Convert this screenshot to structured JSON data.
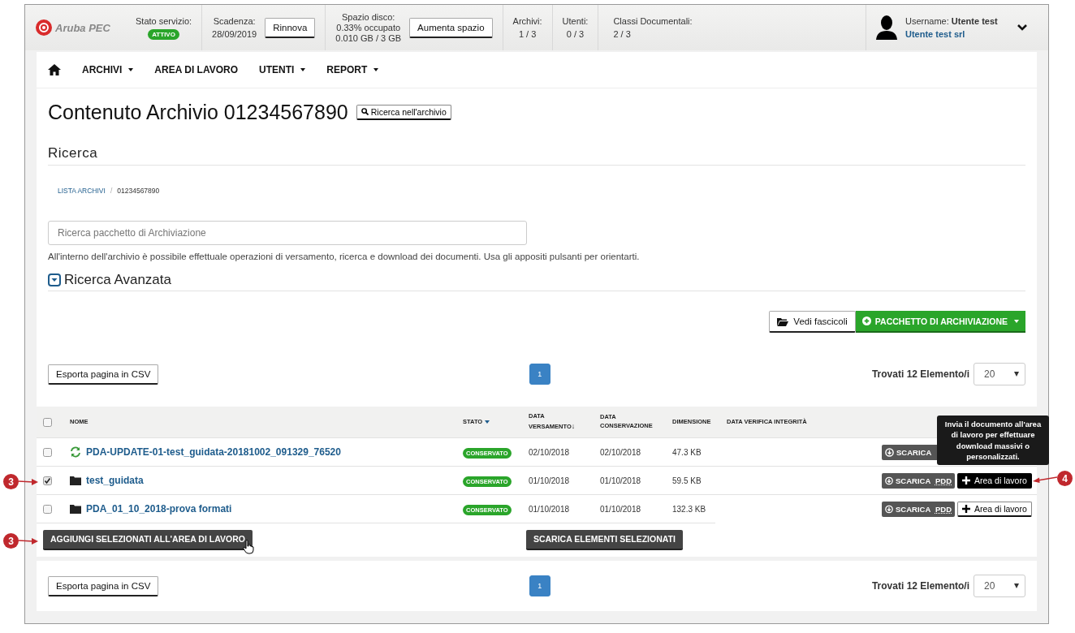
{
  "header": {
    "logo": "Aruba PEC",
    "status": {
      "label": "Stato servizio:",
      "badge": "ATTIVO"
    },
    "expiry": {
      "label": "Scadenza:",
      "value": "28/09/2019",
      "button": "Rinnova"
    },
    "disk": {
      "label": "Spazio disco:",
      "usage": "0.33% occupato",
      "amount": "0.010 GB / 3 GB",
      "button": "Aumenta spazio"
    },
    "counters": [
      {
        "label": "Archivi:",
        "value": "1 / 3"
      },
      {
        "label": "Utenti:",
        "value": "0 / 3"
      },
      {
        "label": "Classi Documentali:",
        "value": "2 / 3"
      }
    ],
    "user": {
      "label": "Username:",
      "name": "Utente test",
      "company": "Utente test srl"
    }
  },
  "nav": [
    {
      "kind": "home"
    },
    {
      "kind": "dropdown",
      "label": "ARCHIVI"
    },
    {
      "kind": "link",
      "label": "AREA DI LAVORO"
    },
    {
      "kind": "dropdown",
      "label": "UTENTI"
    },
    {
      "kind": "dropdown",
      "label": "REPORT"
    }
  ],
  "title": "Contenuto Archivio 01234567890",
  "title_button": "Ricerca nell'archivio",
  "section": "Ricerca",
  "breadcrumb": {
    "separator": "/",
    "items": [
      {
        "label": "LISTA ARCHIVI",
        "kind": "link"
      },
      {
        "label": "01234567890",
        "kind": "current"
      }
    ]
  },
  "search": {
    "placeholder": "Ricerca pacchetto di Archiviazione"
  },
  "help": "All'interno dell'archivio è possibile effettuale operazioni di versamento, ricerca e download dei documenti. Usa gli appositi pulsanti per orientarti.",
  "advanced": {
    "label": "Ricerca Avanzata",
    "expanded": false
  },
  "actions": [
    {
      "kind": "outline",
      "label": "Vedi fascicoli"
    },
    {
      "kind": "green",
      "label": "PACCHETTO DI ARCHIVIAZIONE"
    }
  ],
  "pager_top": {
    "export": "Esporta pagina in CSV",
    "pages": [
      {
        "label": "1",
        "selected": true
      }
    ],
    "found": "Trovati 12 Elemento/i",
    "per_page": "20"
  },
  "table": {
    "all_checked": false,
    "columns": [
      {
        "label": "NOME",
        "kind": "plain"
      },
      {
        "label": "STATO",
        "kind": "dropdown"
      },
      {
        "label": "DATA VERSAMENTO",
        "kind": "sorted",
        "arrow": "↓"
      },
      {
        "label": "DATA CONSERVAZIONE",
        "kind": "plain"
      },
      {
        "label": "DIMENSIONE",
        "kind": "plain"
      },
      {
        "label": "DATA VERIFICA INTEGRITÀ",
        "kind": "plain"
      }
    ],
    "rows": [
      {
        "checked": false,
        "kind": "sync",
        "name": "PDA-UPDATE-01-test_guidata-20181002_091329_76520",
        "status": "CONSERVATO",
        "versamento": "02/10/2018",
        "conservazione": "02/10/2018",
        "size": "47.3 KB",
        "download": "SCARICA"
      },
      {
        "checked": true,
        "kind": "folder",
        "name": "test_guidata",
        "status": "CONSERVATO",
        "versamento": "01/10/2018",
        "conservazione": "01/10/2018",
        "size": "59.5 KB",
        "download": "SCARICA",
        "download_abbr": "PDD",
        "area": "Area di lavoro",
        "active": true
      },
      {
        "checked": false,
        "kind": "folder",
        "name": "PDA_01_10_2018-prova formati",
        "status": "CONSERVATO",
        "versamento": "01/10/2018",
        "conservazione": "01/10/2018",
        "size": "132.3 KB",
        "download": "SCARICA",
        "download_abbr": "PDD",
        "area": "Area di lavoro",
        "active": false
      }
    ]
  },
  "bulk": [
    "AGGIUNGI SELEZIONATI ALL'AREA DI LAVORO",
    "SCARICA ELEMENTI SELEZIONATI"
  ],
  "tooltip": "Invia il documento all'area di lavoro per effettuare download massivi o personalizzati.",
  "pager_bottom": {
    "export": "Esporta pagina in CSV",
    "pages": [
      {
        "label": "1",
        "selected": true
      }
    ],
    "found": "Trovati 12 Elemento/i",
    "per_page": "20"
  },
  "callouts": [
    {
      "number": "3"
    },
    {
      "number": "3"
    },
    {
      "number": "4"
    }
  ]
}
